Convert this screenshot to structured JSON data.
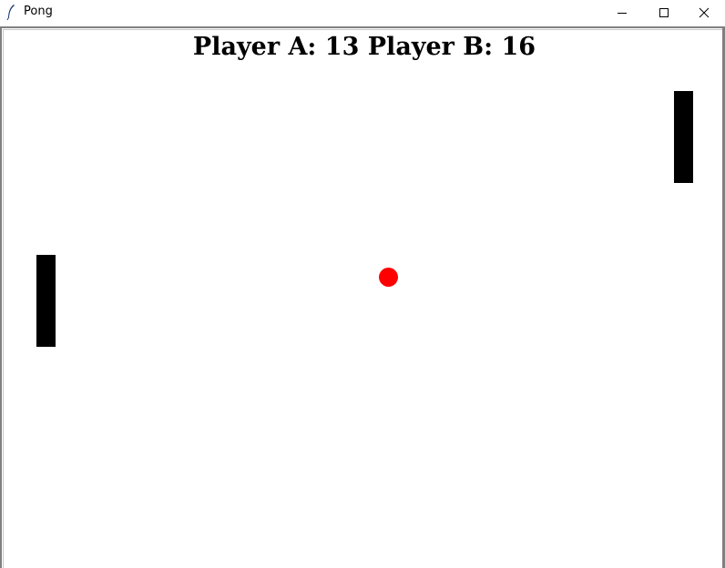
{
  "window": {
    "title": "Pong",
    "icon": "feather-icon",
    "controls": [
      "minimize-icon",
      "maximize-icon",
      "close-icon"
    ]
  },
  "scoreboard": {
    "text": "Player A: 13 Player B: 16",
    "player_a_score": 13,
    "player_b_score": 16
  },
  "game": {
    "background_color": "#ffffff",
    "paddle_color": "#000000",
    "ball_color": "#ff0000"
  }
}
